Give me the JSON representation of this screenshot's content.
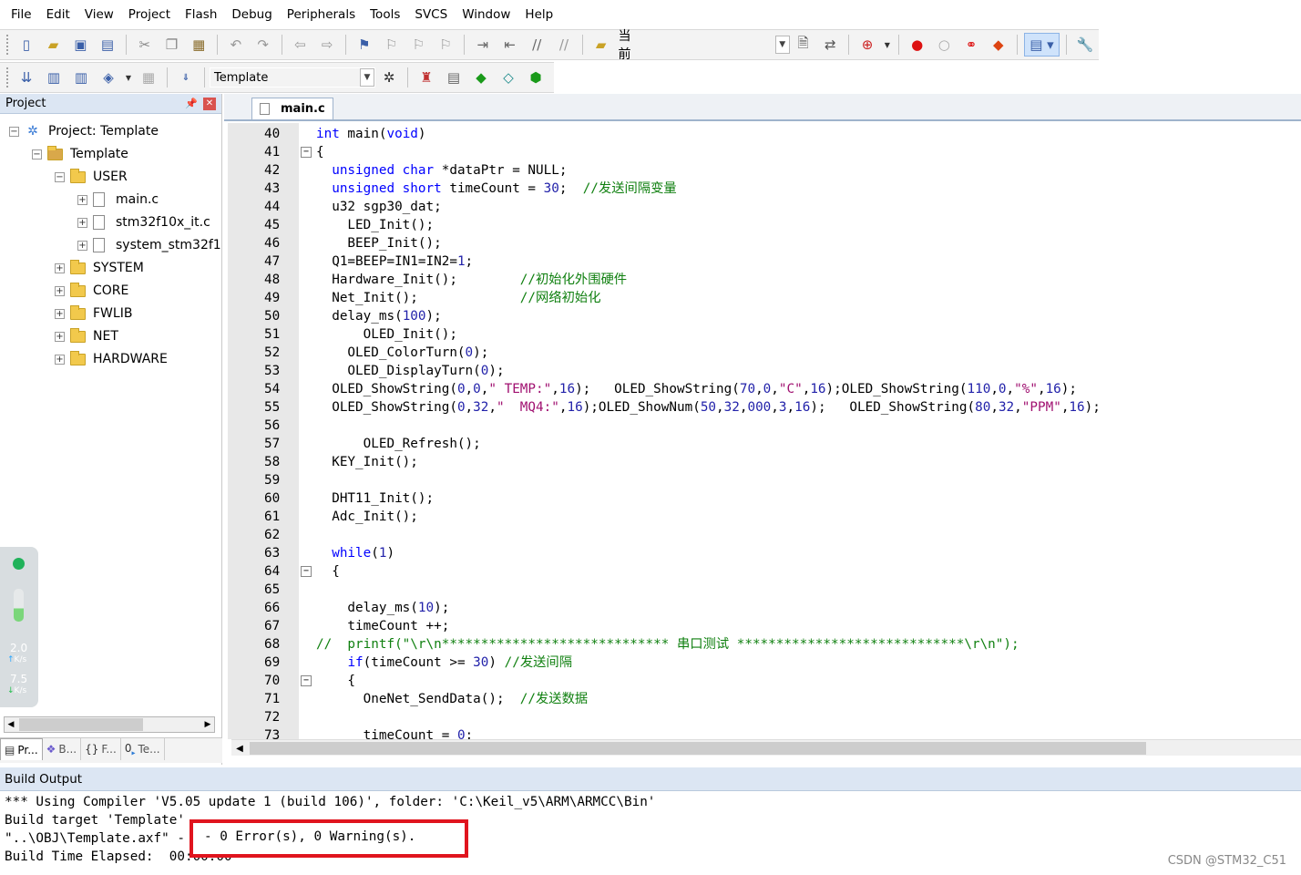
{
  "menu": [
    "File",
    "Edit",
    "View",
    "Project",
    "Flash",
    "Debug",
    "Peripherals",
    "Tools",
    "SVCS",
    "Window",
    "Help"
  ],
  "toolbar1": {
    "find_label": "当前"
  },
  "toolbar2": {
    "target_name": "Template"
  },
  "project_panel": {
    "title": "Project",
    "tree": [
      {
        "label": "Project: Template",
        "level": 0,
        "type": "project",
        "expander": "−"
      },
      {
        "label": "Template",
        "level": 1,
        "type": "target",
        "expander": "−"
      },
      {
        "label": "USER",
        "level": 2,
        "type": "folder",
        "expander": "−"
      },
      {
        "label": "main.c",
        "level": 3,
        "type": "file",
        "expander": "+"
      },
      {
        "label": "stm32f10x_it.c",
        "level": 3,
        "type": "file",
        "expander": "+"
      },
      {
        "label": "system_stm32f1",
        "level": 3,
        "type": "file",
        "expander": "+"
      },
      {
        "label": "SYSTEM",
        "level": 2,
        "type": "folder",
        "expander": "+"
      },
      {
        "label": "CORE",
        "level": 2,
        "type": "folder",
        "expander": "+"
      },
      {
        "label": "FWLIB",
        "level": 2,
        "type": "folder",
        "expander": "+"
      },
      {
        "label": "NET",
        "level": 2,
        "type": "folder",
        "expander": "+"
      },
      {
        "label": "HARDWARE",
        "level": 2,
        "type": "folder",
        "expander": "+"
      }
    ],
    "net_widget": {
      "up_value": "2.0",
      "up_unit": "K/s",
      "down_value": "7.5",
      "down_unit": "K/s"
    },
    "tabs": [
      {
        "icon": "project-tab-icon",
        "label": "Pr..."
      },
      {
        "icon": "books-tab-icon",
        "label": "B..."
      },
      {
        "icon": "functions-tab-icon",
        "label": "F..."
      },
      {
        "icon": "templates-tab-icon",
        "label": "Te..."
      }
    ]
  },
  "editor": {
    "tab_label": "main.c",
    "lines": [
      {
        "n": "40",
        "fold": "",
        "html": "<span class=\"kw\">int</span> main(<span class=\"kw\">void</span>)"
      },
      {
        "n": "41",
        "fold": "−",
        "html": "{"
      },
      {
        "n": "42",
        "fold": "",
        "html": "  <span class=\"kw\">unsigned char</span> *dataPtr = NULL;"
      },
      {
        "n": "43",
        "fold": "",
        "html": "  <span class=\"kw\">unsigned short</span> timeCount = <span class=\"num\">30</span>;  <span class=\"cm\">//发送间隔变量</span>"
      },
      {
        "n": "44",
        "fold": "",
        "html": "  u32 sgp30_dat;"
      },
      {
        "n": "45",
        "fold": "",
        "html": "    LED_Init();"
      },
      {
        "n": "46",
        "fold": "",
        "html": "    BEEP_Init();"
      },
      {
        "n": "47",
        "fold": "",
        "html": "  Q1=BEEP=IN1=IN2=<span class=\"num\">1</span>;"
      },
      {
        "n": "48",
        "fold": "",
        "html": "  Hardware_Init();        <span class=\"cm\">//初始化外围硬件</span>"
      },
      {
        "n": "49",
        "fold": "",
        "html": "  Net_Init();             <span class=\"cm\">//网络初始化</span>"
      },
      {
        "n": "50",
        "fold": "",
        "html": "  delay_ms(<span class=\"num\">100</span>);"
      },
      {
        "n": "51",
        "fold": "",
        "html": "      OLED_Init();"
      },
      {
        "n": "52",
        "fold": "",
        "html": "    OLED_ColorTurn(<span class=\"num\">0</span>);"
      },
      {
        "n": "53",
        "fold": "",
        "html": "    OLED_DisplayTurn(<span class=\"num\">0</span>);"
      },
      {
        "n": "54",
        "fold": "",
        "html": "  OLED_ShowString(<span class=\"num\">0</span>,<span class=\"num\">0</span>,<span class=\"str\">\" TEMP:\"</span>,<span class=\"num\">16</span>);   OLED_ShowString(<span class=\"num\">70</span>,<span class=\"num\">0</span>,<span class=\"str\">\"C\"</span>,<span class=\"num\">16</span>);OLED_ShowString(<span class=\"num\">110</span>,<span class=\"num\">0</span>,<span class=\"str\">\"%\"</span>,<span class=\"num\">16</span>);"
      },
      {
        "n": "55",
        "fold": "",
        "html": "  OLED_ShowString(<span class=\"num\">0</span>,<span class=\"num\">32</span>,<span class=\"str\">\"  MQ4:\"</span>,<span class=\"num\">16</span>);OLED_ShowNum(<span class=\"num\">50</span>,<span class=\"num\">32</span>,<span class=\"num\">000</span>,<span class=\"num\">3</span>,<span class=\"num\">16</span>);   OLED_ShowString(<span class=\"num\">80</span>,<span class=\"num\">32</span>,<span class=\"str\">\"PPM\"</span>,<span class=\"num\">16</span>);"
      },
      {
        "n": "56",
        "fold": "",
        "html": ""
      },
      {
        "n": "57",
        "fold": "",
        "html": "      OLED_Refresh();"
      },
      {
        "n": "58",
        "fold": "",
        "html": "  KEY_Init();"
      },
      {
        "n": "59",
        "fold": "",
        "html": ""
      },
      {
        "n": "60",
        "fold": "",
        "html": "  DHT11_Init();"
      },
      {
        "n": "61",
        "fold": "",
        "html": "  Adc_Init();"
      },
      {
        "n": "62",
        "fold": "",
        "html": ""
      },
      {
        "n": "63",
        "fold": "",
        "html": "  <span class=\"kw\">while</span>(<span class=\"num\">1</span>)"
      },
      {
        "n": "64",
        "fold": "−",
        "html": "  {"
      },
      {
        "n": "65",
        "fold": "",
        "html": ""
      },
      {
        "n": "66",
        "fold": "",
        "html": "    delay_ms(<span class=\"num\">10</span>);"
      },
      {
        "n": "67",
        "fold": "",
        "html": "    timeCount ++;"
      },
      {
        "n": "68",
        "fold": "",
        "html": "<span class=\"cm\">//  printf(\"\\r\\n***************************** 串口测试 *****************************\\r\\n\");</span>"
      },
      {
        "n": "69",
        "fold": "",
        "html": "    <span class=\"kw\">if</span>(timeCount >= <span class=\"num\">30</span>) <span class=\"cm\">//发送间隔</span>"
      },
      {
        "n": "70",
        "fold": "−",
        "html": "    {"
      },
      {
        "n": "71",
        "fold": "",
        "html": "      OneNet_SendData();  <span class=\"cm\">//发送数据</span>"
      },
      {
        "n": "72",
        "fold": "",
        "html": ""
      },
      {
        "n": "73",
        "fold": "",
        "html": "      timeCount = <span class=\"num\">0</span>;"
      }
    ]
  },
  "build_output": {
    "title": "Build Output",
    "lines": [
      "*** Using Compiler 'V5.05 update 1 (build 106)', folder: 'C:\\Keil_v5\\ARM\\ARMCC\\Bin'",
      "Build target 'Template'",
      "\"..\\OBJ\\Template.axf\" - 0 Error(s), 0 Warning(s).",
      "Build Time Elapsed:  00:00:00"
    ],
    "highlight": "- 0 Error(s), 0 Warning(s)."
  },
  "watermark": "CSDN @STM32_C51",
  "colors": {
    "keyword": "#0000ff",
    "comment": "#108010",
    "string": "#a01070",
    "highlight_border": "#e0141e"
  }
}
